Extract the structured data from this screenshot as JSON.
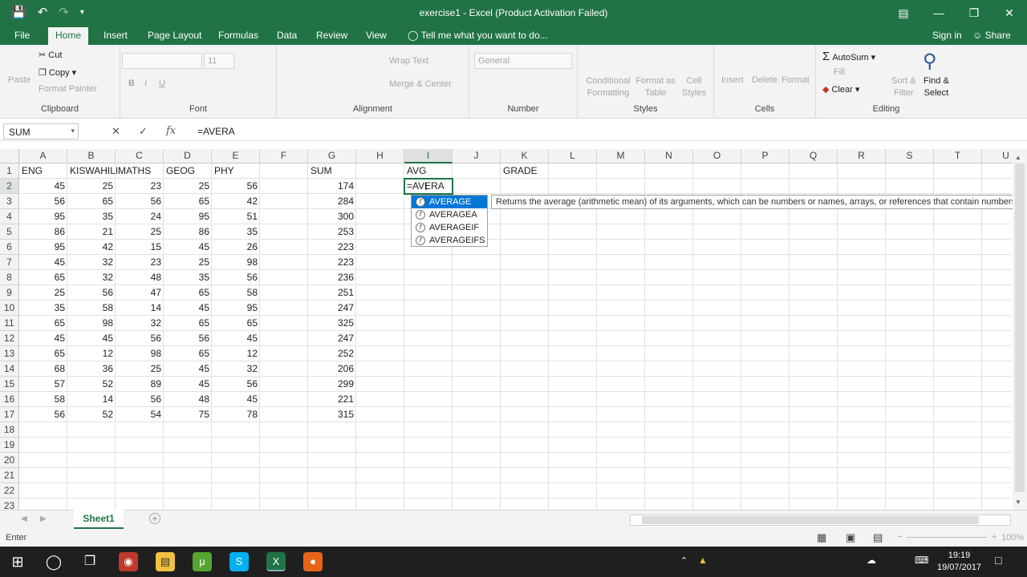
{
  "title": "exercise1 - Excel (Product Activation Failed)",
  "ribbon_tabs": [
    "File",
    "Home",
    "Insert",
    "Page Layout",
    "Formulas",
    "Data",
    "Review",
    "View"
  ],
  "tell_me": "Tell me what you want to do...",
  "sign_in": "Sign in",
  "share": "Share",
  "clipboard": {
    "paste": "Paste",
    "cut": "Cut",
    "copy": "Copy",
    "format_painter": "Format Painter",
    "label": "Clipboard"
  },
  "font": {
    "size": "11",
    "label": "Font"
  },
  "alignment": {
    "wrap": "Wrap Text",
    "merge": "Merge & Center",
    "label": "Alignment"
  },
  "number": {
    "format": "General",
    "label": "Number"
  },
  "styles": {
    "cond": "Conditional",
    "cond2": "Formatting",
    "fmt_table": "Format as",
    "fmt_table2": "Table",
    "cell_styles": "Cell",
    "cell_styles2": "Styles",
    "label": "Styles"
  },
  "cells": {
    "insert": "Insert",
    "delete": "Delete",
    "format": "Format",
    "label": "Cells"
  },
  "editing": {
    "autosum": "AutoSum",
    "fill": "Fill",
    "clear": "Clear",
    "sort": "Sort &",
    "sort2": "Filter",
    "find": "Find &",
    "find2": "Select",
    "label": "Editing"
  },
  "namebox": "SUM",
  "formula": "=AVERA",
  "columns": [
    "A",
    "B",
    "C",
    "D",
    "E",
    "F",
    "G",
    "H",
    "I",
    "J",
    "K",
    "L",
    "M",
    "N",
    "O",
    "P",
    "Q",
    "R",
    "S",
    "T",
    "U"
  ],
  "rows": [
    "1",
    "2",
    "3",
    "4",
    "5",
    "6",
    "7",
    "8",
    "9",
    "10",
    "11",
    "12",
    "13",
    "14",
    "15",
    "16",
    "17",
    "18",
    "19",
    "20",
    "21",
    "22",
    "23"
  ],
  "headers": {
    "a": "ENG",
    "b": "KISWAHILI",
    "c": "MATHS",
    "d": "GEOG",
    "e": "PHY",
    "g": "SUM",
    "i": "AVG",
    "k": "GRADE"
  },
  "data_rows": [
    [
      45,
      25,
      23,
      25,
      56,
      174
    ],
    [
      56,
      65,
      56,
      65,
      42,
      284
    ],
    [
      95,
      35,
      24,
      95,
      51,
      300
    ],
    [
      86,
      21,
      25,
      86,
      35,
      253
    ],
    [
      95,
      42,
      15,
      45,
      26,
      223
    ],
    [
      45,
      32,
      23,
      25,
      98,
      223
    ],
    [
      65,
      32,
      48,
      35,
      56,
      236
    ],
    [
      25,
      56,
      47,
      65,
      58,
      251
    ],
    [
      35,
      58,
      14,
      45,
      95,
      247
    ],
    [
      65,
      98,
      32,
      65,
      65,
      325
    ],
    [
      45,
      45,
      56,
      56,
      45,
      247
    ],
    [
      65,
      12,
      98,
      65,
      12,
      252
    ],
    [
      68,
      36,
      25,
      45,
      32,
      206
    ],
    [
      57,
      52,
      89,
      45,
      56,
      299
    ],
    [
      58,
      14,
      56,
      48,
      45,
      221
    ],
    [
      56,
      52,
      54,
      75,
      78,
      315
    ]
  ],
  "active_text": "=AVERA",
  "autocomplete": [
    "AVERAGE",
    "AVERAGEA",
    "AVERAGEIF",
    "AVERAGEIFS"
  ],
  "tooltip": "Returns the average (arithmetic mean) of its arguments, which can be numbers or names, arrays, or references that contain numbers a",
  "sheet_tab": "Sheet1",
  "status": "Enter",
  "zoom": "100%",
  "clock": {
    "time": "19:19",
    "date": "19/07/2017"
  },
  "colors": {
    "accent": "#217346",
    "select": "#0078d7"
  }
}
